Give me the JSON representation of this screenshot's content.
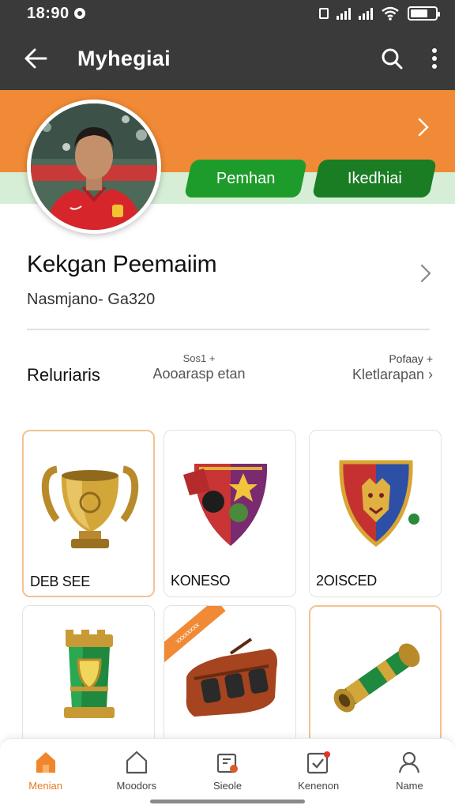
{
  "status_bar": {
    "time": "18:90"
  },
  "app_bar": {
    "title": "Myhegiai"
  },
  "header": {
    "button_primary": "Pemhan",
    "button_secondary": "Ikedhiai"
  },
  "profile": {
    "name": "Kekgan Peemaiim",
    "subtitle": "Nasmjano- Ga320"
  },
  "section": {
    "title": "Reluriaris",
    "middle_small": "Sos1 +",
    "middle_big": "Aooarasp etan",
    "right_small": "Pofaay +",
    "right_big": "Kletlarapan ›"
  },
  "items": [
    {
      "label": "DEB SEE",
      "icon": "trophy-icon"
    },
    {
      "label": "KONESO",
      "icon": "shield-icon"
    },
    {
      "label": "2OISCED",
      "icon": "crest-icon"
    },
    {
      "label": "",
      "icon": "tower-icon"
    },
    {
      "label": "",
      "icon": "pouch-icon",
      "ribbon": "xxxxxxxx"
    },
    {
      "label": "",
      "icon": "scroll-icon"
    }
  ],
  "bottom_nav": [
    {
      "label": "Menian",
      "icon": "home-icon",
      "active": true
    },
    {
      "label": "Moodors",
      "icon": "shop-icon"
    },
    {
      "label": "Sieole",
      "icon": "items-icon"
    },
    {
      "label": "Kenenon",
      "icon": "tasks-icon"
    },
    {
      "label": "Name",
      "icon": "profile-icon"
    }
  ],
  "colors": {
    "accent": "#f08a36",
    "green": "#1e9c2b",
    "dark": "#3a3a3a"
  }
}
